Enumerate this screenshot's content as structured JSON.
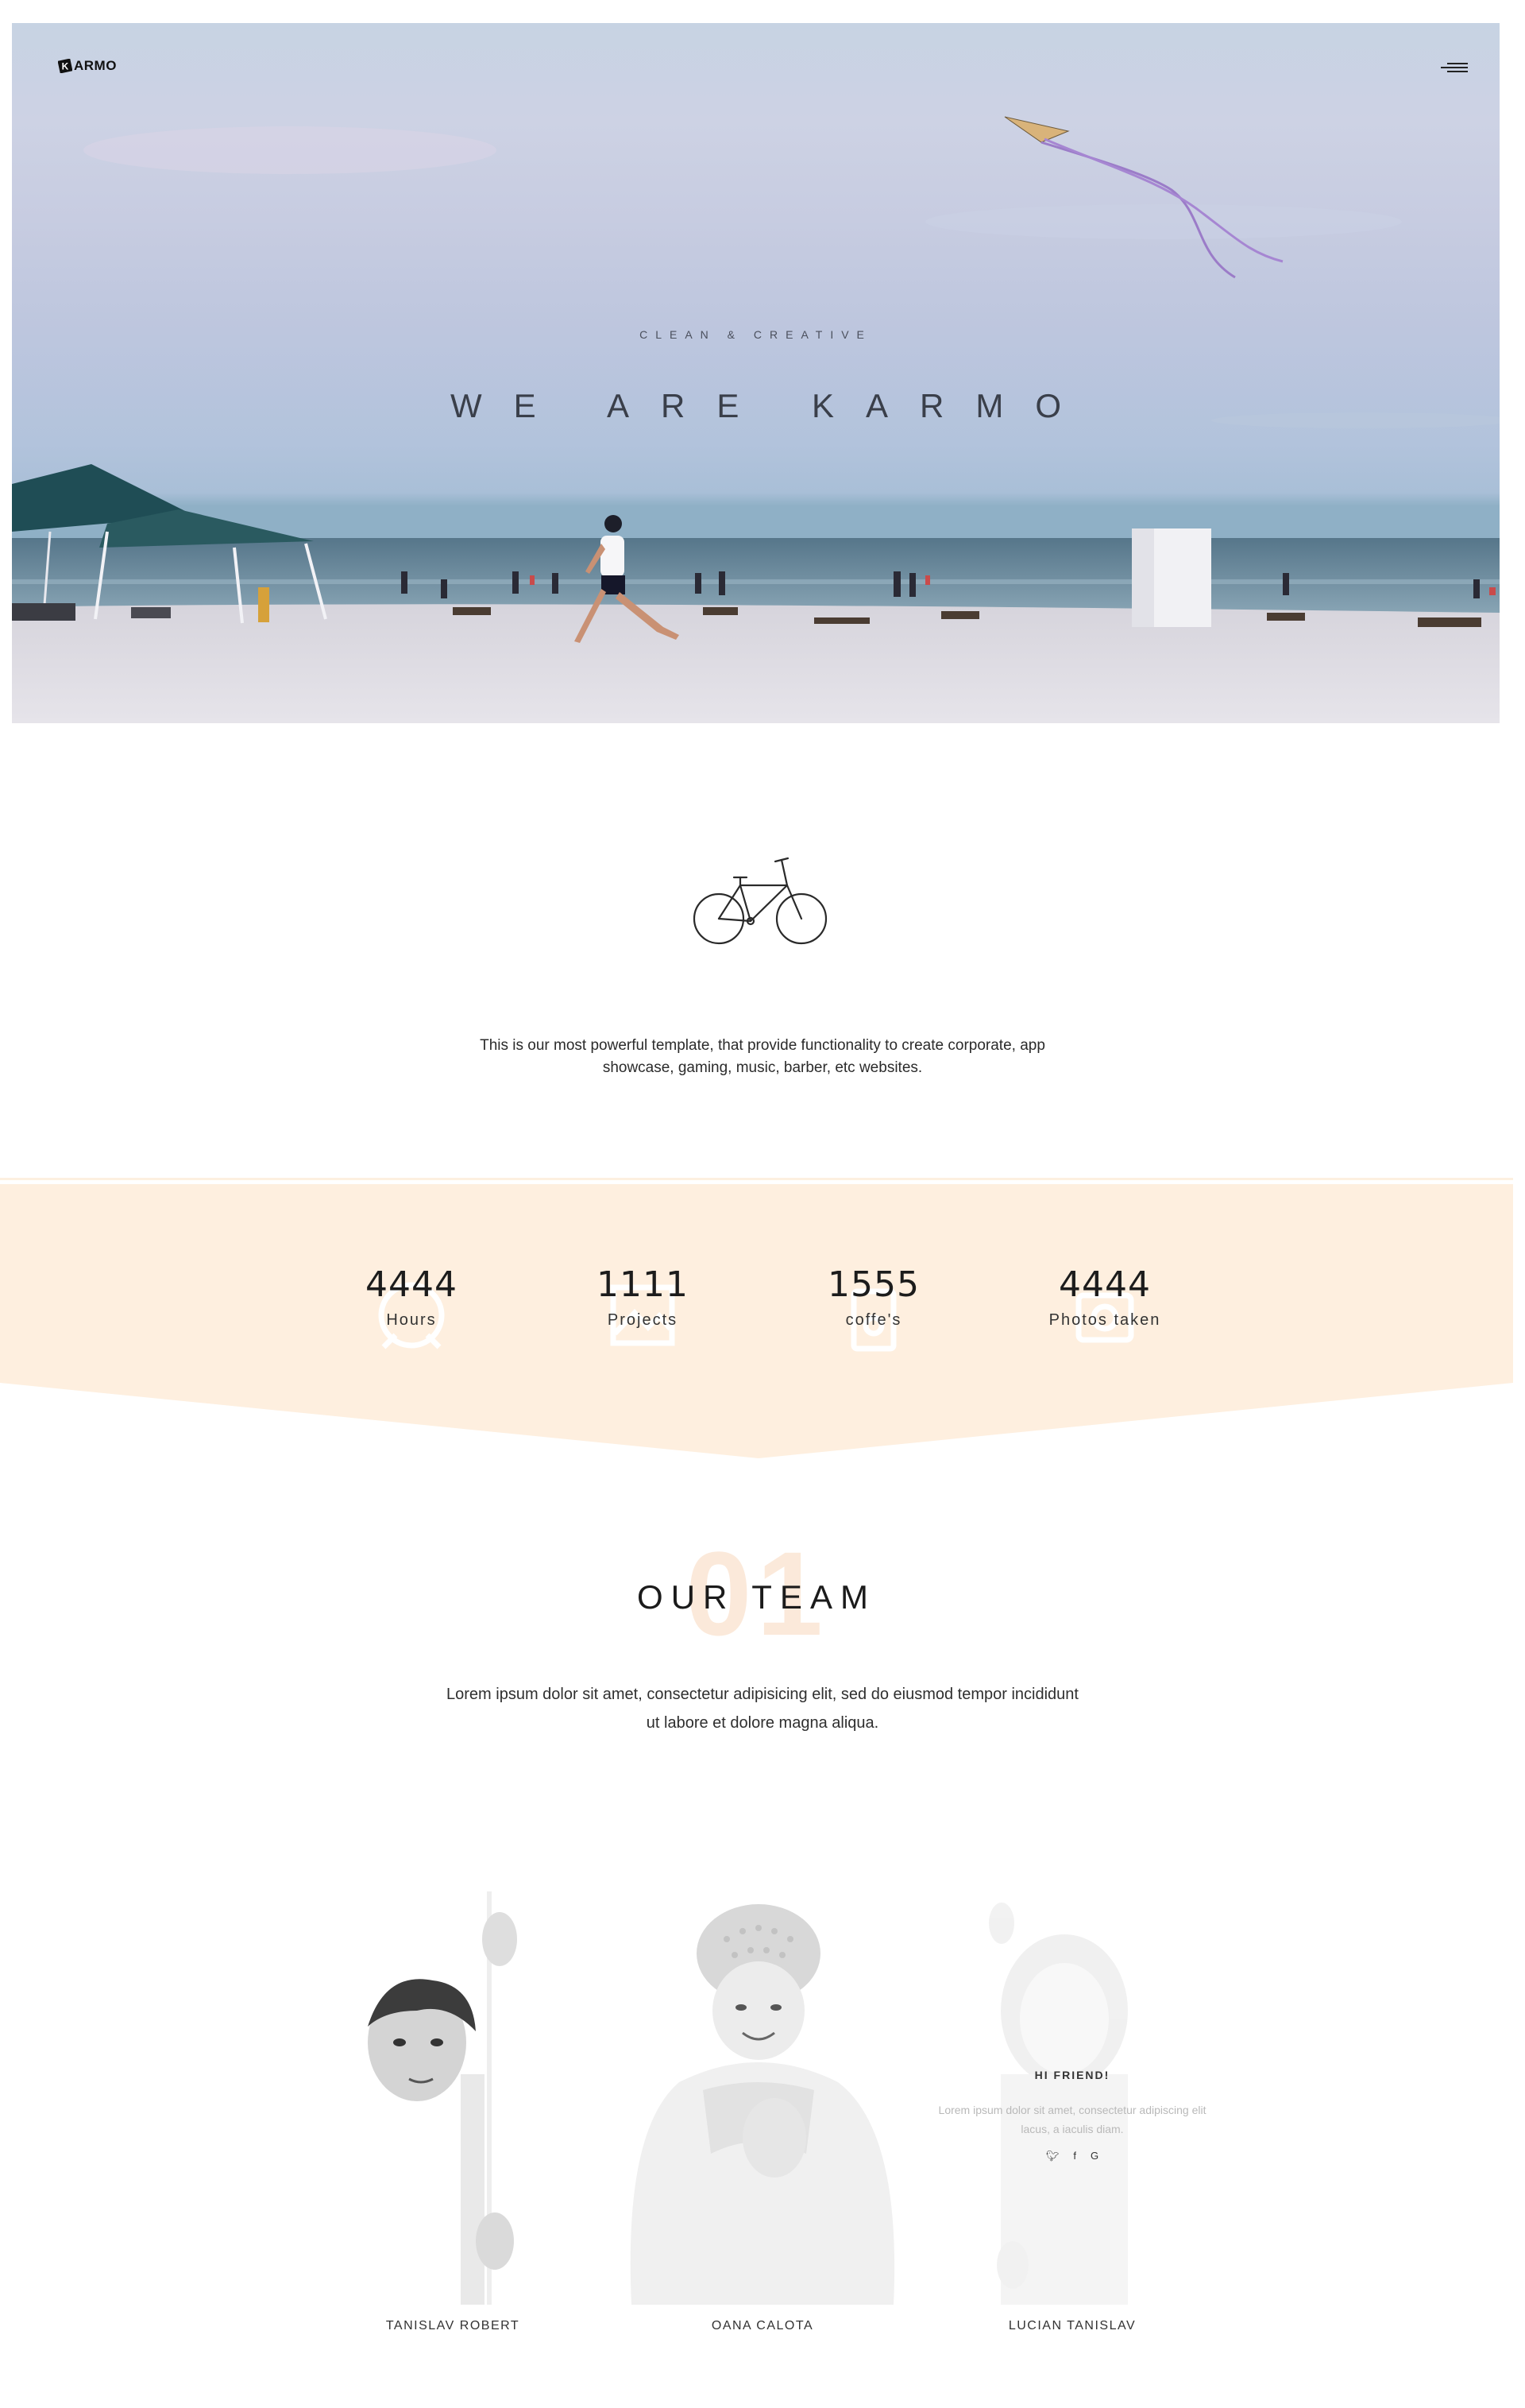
{
  "header": {
    "logo_text": "ARMO",
    "logo_letter": "K"
  },
  "hero": {
    "eyebrow": "CLEAN & CREATIVE",
    "title": "WE ARE KARMO"
  },
  "intro": {
    "text": "This is our most powerful template, that provide functionality to create corporate, app showcase, gaming, music, barber, etc websites."
  },
  "stats": [
    {
      "value": "4444",
      "label": "Hours",
      "icon": "clock-icon"
    },
    {
      "value": "1111",
      "label": "Projects",
      "icon": "image-icon"
    },
    {
      "value": "1555",
      "label": "coffe's",
      "icon": "coffee-icon"
    },
    {
      "value": "4444",
      "label": "Photos taken",
      "icon": "camera-icon"
    }
  ],
  "team": {
    "number": "01",
    "title": "OUR TEAM",
    "description": "Lorem ipsum dolor sit amet, consectetur adipisicing elit, sed do eiusmod tempor incididunt ut labore et dolore magna aliqua.",
    "members": [
      {
        "name": "TANISLAV ROBERT"
      },
      {
        "name": "OANA CALOTA"
      },
      {
        "name": "LUCIAN TANISLAV",
        "greeting": "HI FRIEND!",
        "bio": "Lorem ipsum dolor sit amet, consectetur adipiscing elit lacus, a iaculis diam.",
        "social": [
          "twitter-icon",
          "facebook-icon",
          "google-icon"
        ]
      }
    ]
  },
  "colors": {
    "accent_peach": "#feefdf",
    "text_dark": "#1c1c1c"
  }
}
